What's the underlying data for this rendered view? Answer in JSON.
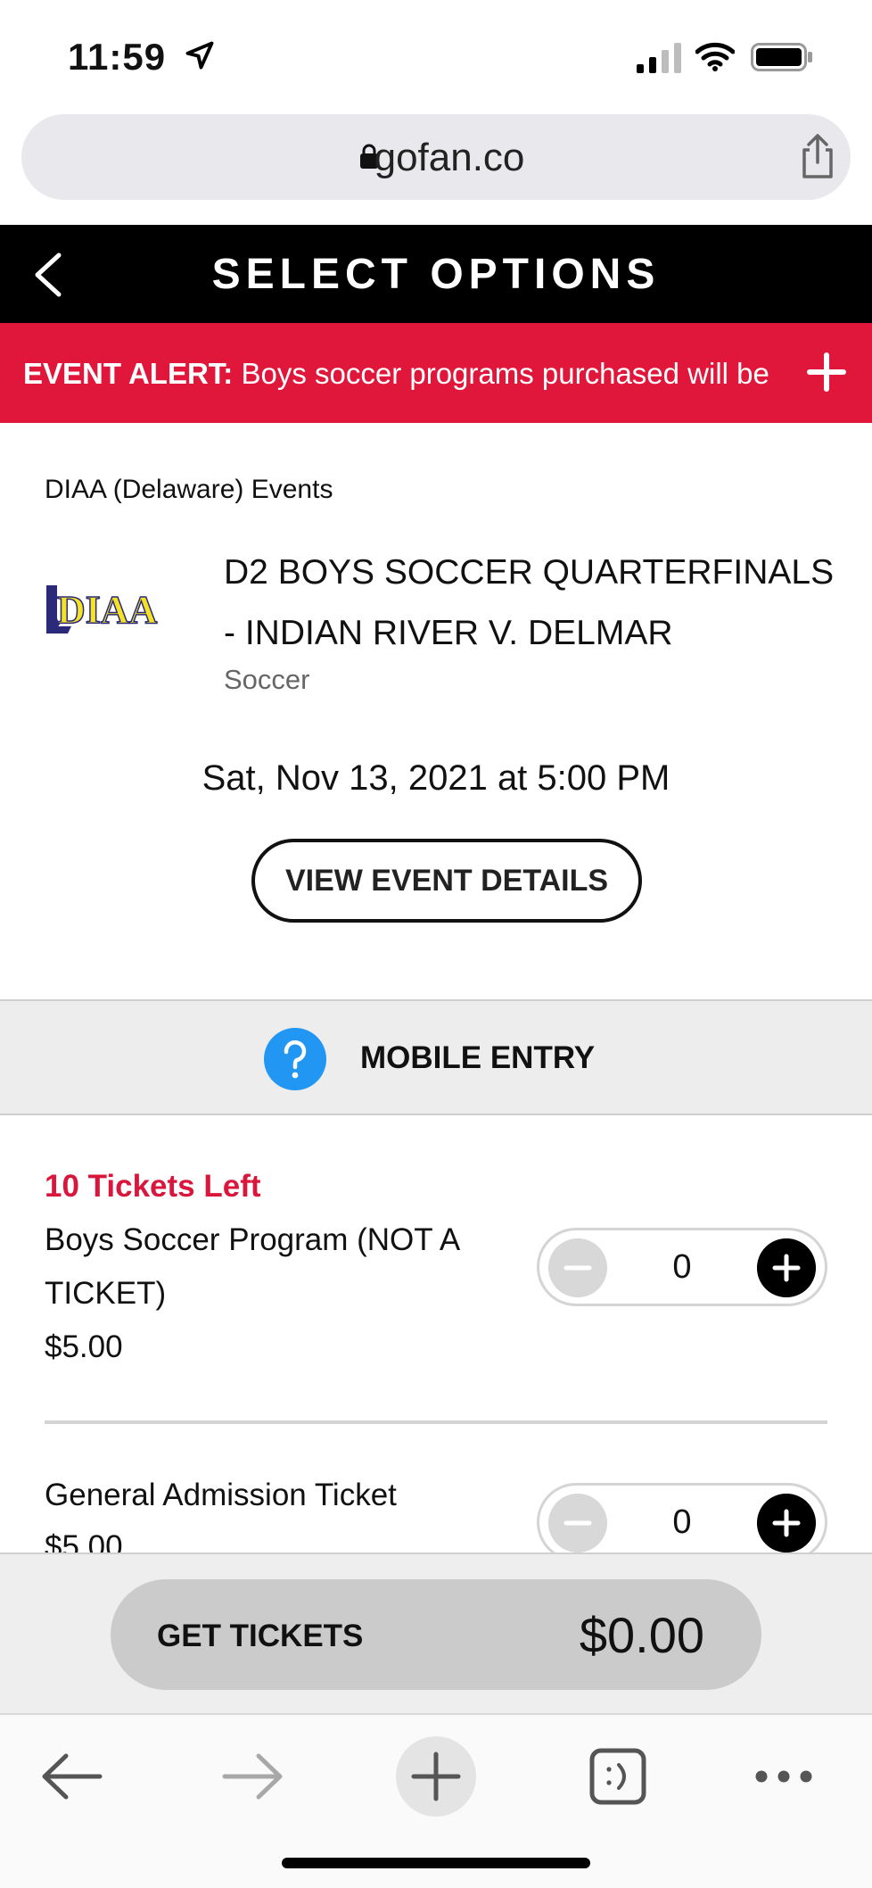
{
  "status_bar": {
    "time": "11:59",
    "icons": [
      "location-arrow-icon",
      "cellular-signal-icon",
      "wifi-icon",
      "battery-icon"
    ]
  },
  "browser": {
    "url": "gofan.co",
    "icons": [
      "lock-icon",
      "share-icon"
    ],
    "toolbar_icons": [
      "back-arrow-icon",
      "forward-arrow-icon",
      "new-tab-plus-icon",
      "tabs-icon",
      "more-icon"
    ]
  },
  "header": {
    "title": "SELECT OPTIONS"
  },
  "alert": {
    "label": "EVENT ALERT:",
    "message": " Boys soccer programs purchased will be"
  },
  "event": {
    "organization": "DIAA (Delaware) Events",
    "logo_text": "DIAA",
    "title": "D2 BOYS SOCCER QUARTERFINALS - INDIAN RIVER V. DELMAR",
    "sport": "Soccer",
    "date": "Sat, Nov 13, 2021 at 5:00 PM",
    "details_button": "VIEW EVENT DETAILS"
  },
  "mobile_entry": {
    "label": "MOBILE ENTRY"
  },
  "tickets": [
    {
      "availability": "10 Tickets Left",
      "name": "Boys Soccer Program (NOT A TICKET)",
      "price": "$5.00",
      "quantity": "0"
    },
    {
      "name": "General Admission Ticket",
      "price": "$5.00",
      "quantity": "0"
    }
  ],
  "checkout": {
    "button_label": "GET TICKETS",
    "total": "$0.00"
  },
  "colors": {
    "header_bg": "#000000",
    "alert_bg": "#e0173a",
    "tickets_left": "#d9163c",
    "help_icon": "#2196f3",
    "checkout_button": "#cbcbcb"
  }
}
